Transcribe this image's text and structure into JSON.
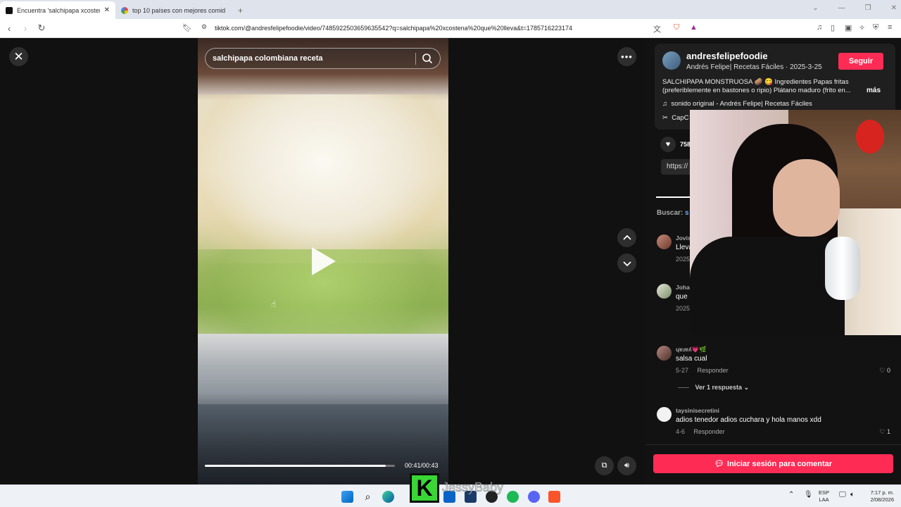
{
  "browser": {
    "tabs": [
      {
        "title": "Encuentra 'salchipapa xcostena ...",
        "active": true
      },
      {
        "title": "top 10 países con mejores comidas ...",
        "active": false
      }
    ],
    "url": "tiktok.com/@andresfelipefoodie/video/7485922503659635542?q=salchipapa%20xcostena%20que%20lleva&t=1785716223174"
  },
  "video": {
    "search_value": "salchipapa colombiana receta",
    "progress": 0.953,
    "time": "00:41/00:43"
  },
  "post": {
    "username": "andresfelipefoodie",
    "subtitle": "Andrés Felipe| Recetas Fáciles · 2025-3-25",
    "follow_label": "Seguir",
    "description": "SALCHIPAPA MONSTRUOSA 🥔 😋 Ingredientes Papas fritas (preferiblemente en bastones o ripio) Plátano maduro (frito en...",
    "more_label": "más",
    "sound": "sonido original - Andrés Felipe| Recetas Fáciles",
    "capcut": "CapC",
    "likes": "758",
    "link_prefix": "https://",
    "search_label": "Buscar:",
    "search_term": "s"
  },
  "comments": [
    {
      "user": "Jovis",
      "text": "Lleva",
      "date": "2025",
      "reply": "",
      "likes": ""
    },
    {
      "user": "Joha",
      "text": "que",
      "date": "2025",
      "reply": "",
      "likes": ""
    },
    {
      "user": "ɥɐɹɐʎ💗🌿",
      "text": "salsa cual",
      "date": "5-27",
      "reply": "Responder",
      "likes": "0"
    },
    {
      "user": "taysinisecretini",
      "text": "adios tenedor adios cuchara y hola manos xdd",
      "date": "4-6",
      "reply": "Responder",
      "likes": "1"
    }
  ],
  "view_replies": "Ver 1 respuesta",
  "comment_button": "Iniciar sesión para comentar",
  "overlay": {
    "streamer": "JessyBaby",
    "logo_letter": "K"
  },
  "taskbar": {
    "lang_top": "ESP",
    "lang_bottom": "LAA",
    "time": "7:17 p. m.",
    "date": "2/08/2026"
  },
  "colors": {
    "accent": "#fe2c55",
    "kick_green": "#39d636"
  }
}
